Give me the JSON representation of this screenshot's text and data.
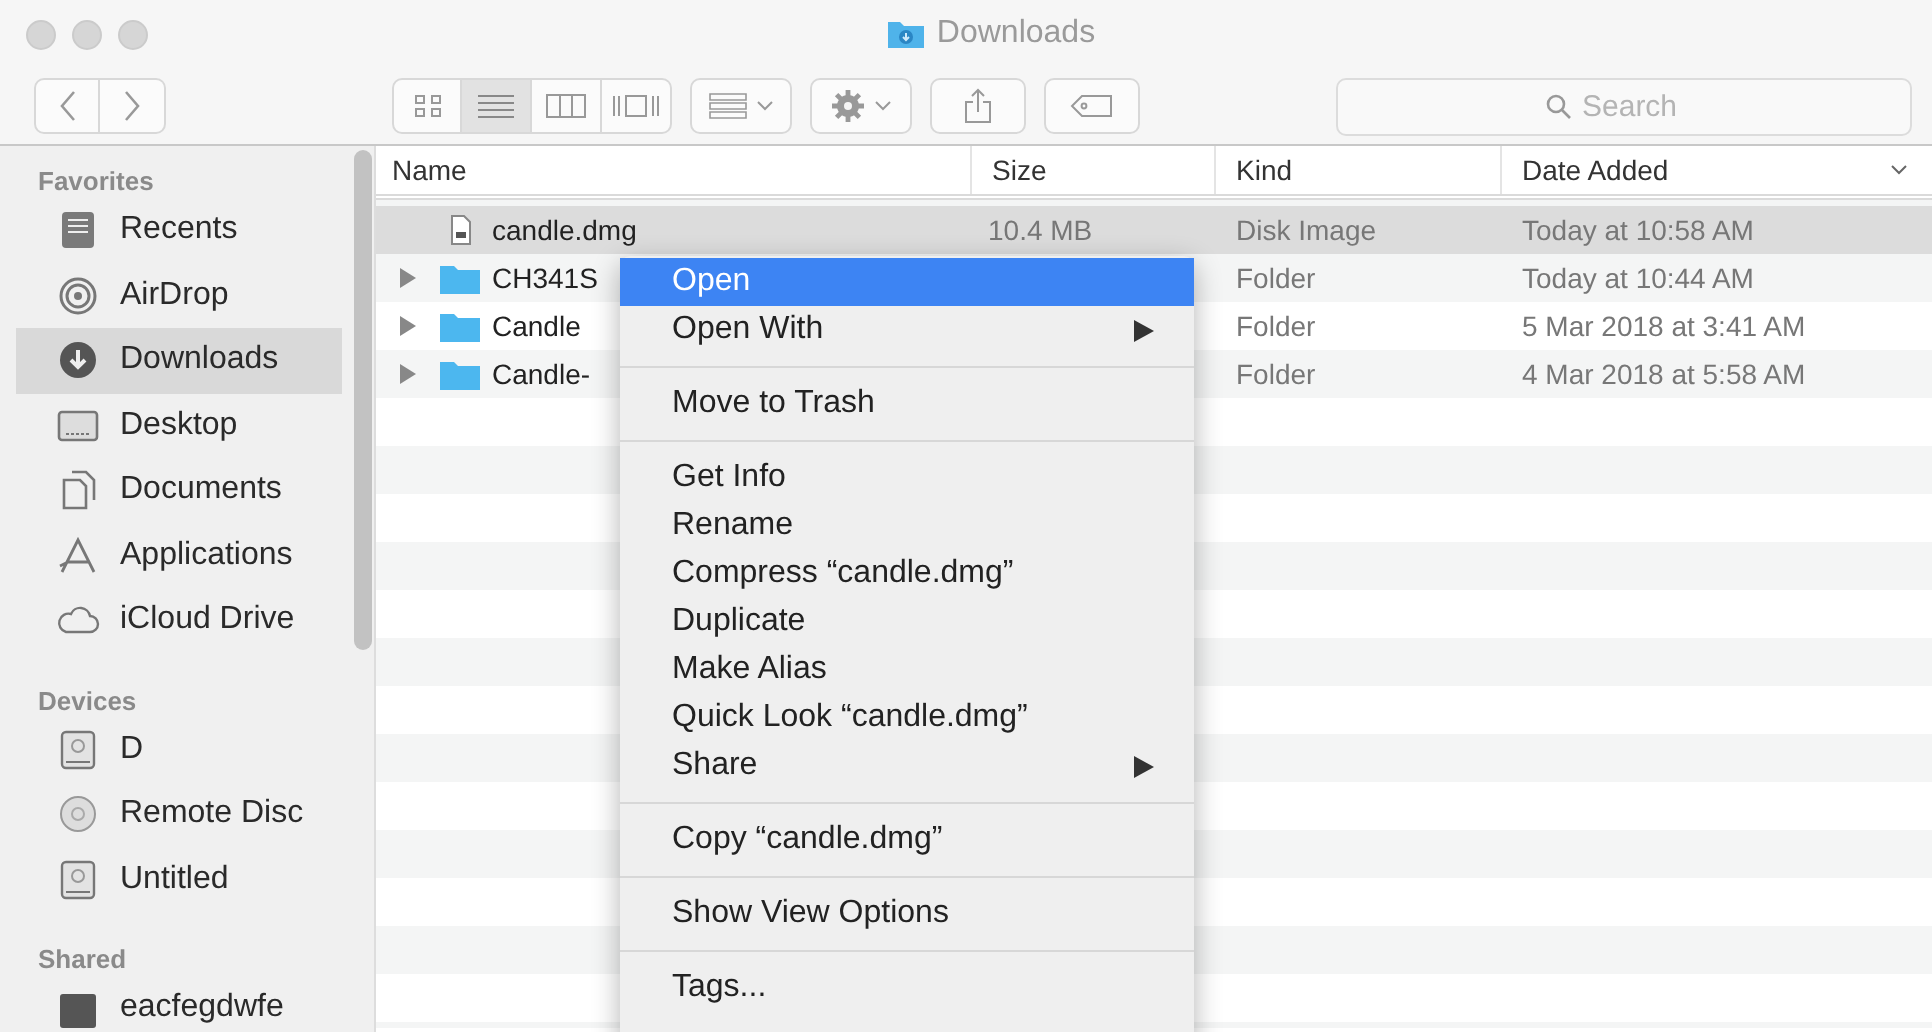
{
  "window": {
    "title": "Downloads"
  },
  "toolbar": {
    "views": [
      {
        "selected": false
      },
      {
        "selected": true
      },
      {
        "selected": false
      },
      {
        "selected": false
      }
    ],
    "search": {
      "placeholder": "Search"
    }
  },
  "sidebar": {
    "sections": [
      {
        "title": "Favorites",
        "items": [
          {
            "label": "Recents",
            "selected": false
          },
          {
            "label": "AirDrop",
            "selected": false
          },
          {
            "label": "Downloads",
            "selected": true
          },
          {
            "label": "Desktop",
            "selected": false
          },
          {
            "label": "Documents",
            "selected": false
          },
          {
            "label": "Applications",
            "selected": false
          },
          {
            "label": "iCloud Drive",
            "selected": false
          }
        ]
      },
      {
        "title": "Devices",
        "items": [
          {
            "label": "D",
            "selected": false
          },
          {
            "label": "Remote Disc",
            "selected": false
          },
          {
            "label": "Untitled",
            "selected": false
          }
        ]
      },
      {
        "title": "Shared",
        "items": [
          {
            "label": "eacfegdwfe",
            "selected": false
          }
        ]
      }
    ]
  },
  "table": {
    "columns": [
      {
        "label": "Name",
        "sorted": false
      },
      {
        "label": "Size",
        "sorted": false
      },
      {
        "label": "Kind",
        "sorted": false
      },
      {
        "label": "Date Added",
        "sorted": true
      }
    ],
    "rows": [
      {
        "kind": "file",
        "name": "candle.dmg",
        "size": "10.4 MB",
        "type": "Disk Image",
        "date": "Today at 10:58 AM",
        "selected": true
      },
      {
        "kind": "folder",
        "name": "CH341S",
        "type": "Folder",
        "date": "Today at 10:44 AM",
        "selected": false
      },
      {
        "kind": "folder",
        "name": "Candle",
        "type": "Folder",
        "date": "5 Mar 2018 at 3:41 AM",
        "selected": false
      },
      {
        "kind": "folder",
        "name": "Candle-",
        "type": "Folder",
        "date": "4 Mar 2018 at 5:58 AM",
        "selected": false
      }
    ]
  },
  "context_menu": {
    "items": [
      {
        "kind": "item",
        "label": "Open",
        "selected": true,
        "submenu": false
      },
      {
        "kind": "item",
        "label": "Open With",
        "selected": false,
        "submenu": true
      },
      {
        "kind": "separator"
      },
      {
        "kind": "item",
        "label": "Move to Trash",
        "selected": false,
        "submenu": false
      },
      {
        "kind": "separator"
      },
      {
        "kind": "item",
        "label": "Get Info",
        "selected": false,
        "submenu": false
      },
      {
        "kind": "item",
        "label": "Rename",
        "selected": false,
        "submenu": false
      },
      {
        "kind": "item",
        "label": "Compress “candle.dmg”",
        "selected": false,
        "submenu": false
      },
      {
        "kind": "item",
        "label": "Duplicate",
        "selected": false,
        "submenu": false
      },
      {
        "kind": "item",
        "label": "Make Alias",
        "selected": false,
        "submenu": false
      },
      {
        "kind": "item",
        "label": "Quick Look “candle.dmg”",
        "selected": false,
        "submenu": false
      },
      {
        "kind": "item",
        "label": "Share",
        "selected": false,
        "submenu": true
      },
      {
        "kind": "separator"
      },
      {
        "kind": "item",
        "label": "Copy “candle.dmg”",
        "selected": false,
        "submenu": false
      },
      {
        "kind": "separator"
      },
      {
        "kind": "item",
        "label": "Show View Options",
        "selected": false,
        "submenu": false
      },
      {
        "kind": "separator"
      },
      {
        "kind": "item",
        "label": "Tags...",
        "selected": false,
        "submenu": false
      }
    ]
  }
}
